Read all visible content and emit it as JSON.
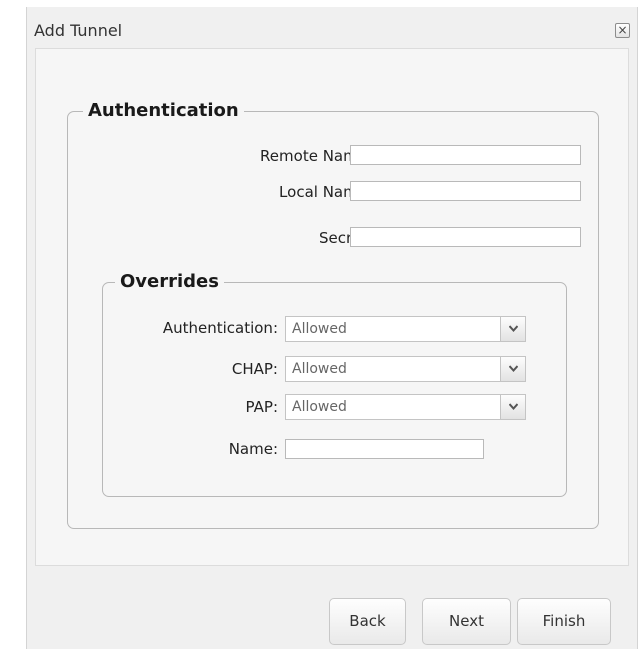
{
  "dialog": {
    "title": "Add Tunnel",
    "close_glyph": "×"
  },
  "authentication": {
    "legend": "Authentication",
    "remote_name": {
      "label": "Remote Name:",
      "value": ""
    },
    "local_name": {
      "label": "Local Name:",
      "value": ""
    },
    "secret": {
      "label": "Secret:",
      "value": ""
    }
  },
  "overrides": {
    "legend": "Overrides",
    "authentication": {
      "label": "Authentication:",
      "value": "Allowed"
    },
    "chap": {
      "label": "CHAP:",
      "value": "Allowed"
    },
    "pap": {
      "label": "PAP:",
      "value": "Allowed"
    },
    "name": {
      "label": "Name:",
      "value": ""
    }
  },
  "buttons": {
    "back": "Back",
    "next": "Next",
    "finish": "Finish"
  },
  "icons": {
    "close": "close-icon",
    "dropdown": "chevron-down-icon"
  }
}
